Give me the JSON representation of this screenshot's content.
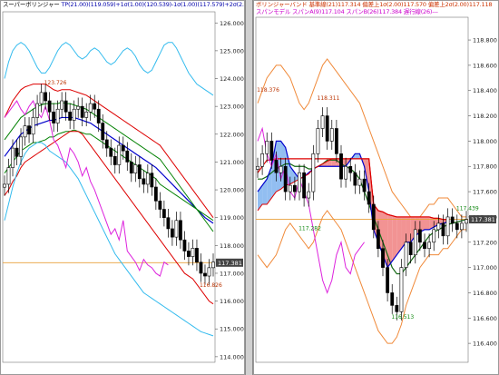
{
  "left": {
    "header": {
      "title": "スーパーボリンジャー",
      "params": "TP(21.00)(119.059)+1σ(1.00)(120.539)-1σ(1.00)(117.579)+2σ(2.00)(122.018)-2σ(2.00)"
    },
    "price_tag": "117.381",
    "colors": {
      "mid": "#0000cc",
      "s1": "#008000",
      "s2": "#dd0000",
      "s3": "#33bbee",
      "chikou": "#dd22dd",
      "price": "#000000",
      "current": "#e8a13a"
    }
  },
  "right": {
    "header": {
      "line1": "ボリンジャーバンド  基準線(21)117.314  偏差上1σ(2.00)117.570  偏差上2σ(2.00)117.118",
      "line2": "スパンモデル  スパンA(9)117.104  スパンB(26)117.384  遅行線(26)---"
    },
    "price_tag": "117.381",
    "colors": {
      "bb_outer": "#f08a3a",
      "mid": "#116611",
      "red_line": "#dd0000",
      "blue_line": "#0000cc",
      "chikou": "#dd22dd",
      "cloud_up": "#7fb3ee",
      "cloud_down": "#f08080"
    }
  },
  "chart_data": [
    {
      "type": "line",
      "title": "スーパーボリンジャー",
      "y_ticks": [
        "126.000",
        "125.000",
        "124.000",
        "123.000",
        "122.000",
        "121.000",
        "120.000",
        "119.000",
        "118.000",
        "117.000",
        "116.000",
        "115.000",
        "114.000"
      ],
      "ylim": [
        113.8,
        126.4
      ],
      "current_price": 117.381,
      "annotations": [
        {
          "text": "123.726",
          "x": 11,
          "y": 123.726
        },
        {
          "text": "116.826",
          "x": 49,
          "y": 116.45
        }
      ],
      "close": [
        120.2,
        120.8,
        121.5,
        121.2,
        121.9,
        122.3,
        122.0,
        122.6,
        123.1,
        123.5,
        123.2,
        122.8,
        122.4,
        122.9,
        123.2,
        122.8,
        122.5,
        122.9,
        123.0,
        122.6,
        122.8,
        123.1,
        122.9,
        122.4,
        121.8,
        121.5,
        121.2,
        120.9,
        121.6,
        121.4,
        121.0,
        120.6,
        120.9,
        120.4,
        120.2,
        120.6,
        120.1,
        119.6,
        119.3,
        119.0,
        118.6,
        118.3,
        118.9,
        118.2,
        117.8,
        117.6,
        117.9,
        117.4,
        117.0,
        116.9,
        117.2,
        117.4
      ],
      "series": [
        {
          "name": "mid",
          "values": [
            121.2,
            121.4,
            121.6,
            121.8,
            122.0,
            122.1,
            122.2,
            122.3,
            122.35,
            122.4,
            122.45,
            122.5,
            122.5,
            122.55,
            122.6,
            122.6,
            122.6,
            122.6,
            122.55,
            122.5,
            122.45,
            122.4,
            122.3,
            122.2,
            122.1,
            122.0,
            121.9,
            121.8,
            121.7,
            121.6,
            121.5,
            121.4,
            121.3,
            121.2,
            121.1,
            121.0,
            120.9,
            120.8,
            120.65,
            120.5,
            120.35,
            120.2,
            120.05,
            119.9,
            119.75,
            119.6,
            119.45,
            119.3,
            119.15,
            119.0,
            118.9,
            118.8
          ]
        },
        {
          "name": "+1σ",
          "values": [
            121.8,
            122.0,
            122.2,
            122.4,
            122.6,
            122.7,
            122.8,
            122.9,
            123.0,
            123.05,
            123.1,
            123.1,
            123.1,
            123.1,
            123.15,
            123.1,
            123.1,
            123.05,
            123.0,
            122.95,
            122.9,
            122.8,
            122.7,
            122.6,
            122.5,
            122.4,
            122.3,
            122.2,
            122.1,
            122.0,
            121.9,
            121.8,
            121.7,
            121.6,
            121.5,
            121.4,
            121.3,
            121.2,
            121.1,
            120.9,
            120.7,
            120.5,
            120.3,
            120.1,
            119.9,
            119.7,
            119.5,
            119.3,
            119.1,
            118.9,
            118.7,
            118.5
          ]
        },
        {
          "name": "-1σ",
          "values": [
            120.6,
            120.8,
            121.0,
            121.2,
            121.4,
            121.5,
            121.6,
            121.7,
            121.7,
            121.75,
            121.8,
            121.9,
            121.9,
            122.0,
            122.05,
            122.1,
            122.1,
            122.15,
            122.1,
            122.05,
            122.0,
            122.0,
            121.9,
            121.8,
            121.7,
            121.6,
            121.5,
            121.4,
            121.3,
            121.2,
            121.1,
            121.0,
            120.9,
            120.8,
            120.7,
            120.6,
            120.5,
            120.4,
            120.2,
            120.1,
            120.0,
            119.9,
            119.8,
            119.7,
            119.6,
            119.5,
            119.4,
            119.3,
            119.2,
            119.1,
            119.0,
            118.9
          ]
        },
        {
          "name": "+2σ",
          "values": [
            122.6,
            122.9,
            123.2,
            123.4,
            123.6,
            123.7,
            123.75,
            123.8,
            123.8,
            123.8,
            123.8,
            123.7,
            123.6,
            123.55,
            123.6,
            123.6,
            123.6,
            123.55,
            123.5,
            123.45,
            123.4,
            123.3,
            123.2,
            123.1,
            123.0,
            122.9,
            122.8,
            122.7,
            122.6,
            122.5,
            122.4,
            122.3,
            122.2,
            122.1,
            122.0,
            121.9,
            121.8,
            121.7,
            121.6,
            121.4,
            121.2,
            121.0,
            120.8,
            120.6,
            120.4,
            120.2,
            120.0,
            119.8,
            119.6,
            119.4,
            119.2,
            119.0
          ]
        },
        {
          "name": "-2σ",
          "values": [
            119.8,
            120.0,
            120.3,
            120.5,
            120.8,
            121.0,
            121.1,
            121.2,
            121.3,
            121.4,
            121.5,
            121.6,
            121.7,
            121.8,
            121.9,
            122.0,
            122.1,
            122.1,
            122.1,
            122.0,
            121.8,
            121.6,
            121.4,
            121.2,
            121.0,
            120.8,
            120.6,
            120.4,
            120.2,
            120.0,
            119.8,
            119.6,
            119.4,
            119.2,
            119.0,
            118.8,
            118.6,
            118.4,
            118.2,
            118.0,
            117.8,
            117.6,
            117.4,
            117.2,
            117.0,
            116.9,
            116.8,
            116.6,
            116.4,
            116.2,
            116.0,
            115.9
          ]
        },
        {
          "name": "+3σ",
          "values": [
            124.0,
            124.6,
            125.0,
            125.2,
            125.3,
            125.2,
            125.0,
            124.7,
            124.4,
            124.2,
            124.2,
            124.4,
            124.7,
            125.0,
            125.2,
            125.3,
            125.2,
            125.0,
            124.8,
            124.7,
            124.8,
            125.0,
            125.1,
            125.0,
            124.8,
            124.6,
            124.5,
            124.6,
            124.8,
            125.0,
            125.1,
            125.0,
            124.8,
            124.5,
            124.3,
            124.2,
            124.3,
            124.6,
            124.9,
            125.2,
            125.3,
            125.3,
            125.1,
            124.8,
            124.5,
            124.2,
            124.0,
            123.8,
            123.7,
            123.6,
            123.5,
            123.4
          ]
        },
        {
          "name": "-3σ",
          "values": [
            118.9,
            119.5,
            120.1,
            120.6,
            121.0,
            121.3,
            121.5,
            121.6,
            121.7,
            121.7,
            121.6,
            121.4,
            121.3,
            121.2,
            121.1,
            121.0,
            120.8,
            120.6,
            120.4,
            120.1,
            119.8,
            119.5,
            119.2,
            118.9,
            118.6,
            118.3,
            118.0,
            117.7,
            117.5,
            117.3,
            117.1,
            116.9,
            116.7,
            116.5,
            116.3,
            116.2,
            116.1,
            116.0,
            115.9,
            115.8,
            115.7,
            115.6,
            115.5,
            115.4,
            115.3,
            115.2,
            115.1,
            115.0,
            114.9,
            114.85,
            114.8,
            114.75
          ]
        },
        {
          "name": "chikou",
          "values": [
            122.6,
            122.8,
            123.0,
            123.2,
            122.9,
            122.7,
            123.0,
            123.2,
            122.8,
            122.6,
            123.0,
            122.5,
            121.8,
            121.6,
            121.2,
            120.8,
            121.5,
            121.3,
            121.0,
            120.5,
            120.8,
            120.3,
            120.0,
            119.6,
            119.2,
            118.8,
            118.4,
            118.6,
            118.2,
            118.9,
            117.8,
            117.6,
            117.4,
            117.1,
            117.5,
            117.3,
            117.2,
            117.0,
            116.9,
            117.4,
            117.3
          ]
        }
      ]
    },
    {
      "type": "line",
      "title": "ボリンジャーバンド / スパンモデル",
      "y_ticks": [
        "118.800",
        "118.600",
        "118.400",
        "118.200",
        "118.000",
        "117.800",
        "117.600",
        "117.400",
        "117.200",
        "117.000",
        "116.800",
        "116.600",
        "116.400"
      ],
      "ylim": [
        116.25,
        118.98
      ],
      "current_price": 117.381,
      "annotations": [
        {
          "text": "118.376",
          "x": 1,
          "y": 118.376
        },
        {
          "text": "118.311",
          "x": 14,
          "y": 118.311
        },
        {
          "text": "117.282",
          "x": 10,
          "y": 117.282
        },
        {
          "text": "117.439",
          "x": 44,
          "y": 117.439
        },
        {
          "text": "116.513",
          "x": 30,
          "y": 116.58
        }
      ],
      "close": [
        117.8,
        117.9,
        118.0,
        117.85,
        117.75,
        117.8,
        117.6,
        117.65,
        117.6,
        117.75,
        117.55,
        117.6,
        117.9,
        118.1,
        118.2,
        118.0,
        118.1,
        117.9,
        117.7,
        117.8,
        117.75,
        117.65,
        117.7,
        117.6,
        117.5,
        117.3,
        117.15,
        117.0,
        116.8,
        116.7,
        116.65,
        117.0,
        117.2,
        117.1,
        117.3,
        117.2,
        117.15,
        117.2,
        117.3,
        117.35,
        117.25,
        117.4,
        117.35,
        117.3,
        117.35,
        117.38
      ],
      "series": [
        {
          "name": "bb_upper",
          "values": [
            118.3,
            118.4,
            118.5,
            118.55,
            118.6,
            118.6,
            118.55,
            118.5,
            118.4,
            118.3,
            118.25,
            118.3,
            118.4,
            118.5,
            118.6,
            118.65,
            118.6,
            118.55,
            118.5,
            118.45,
            118.4,
            118.35,
            118.3,
            118.2,
            118.1,
            118.0,
            117.9,
            117.8,
            117.7,
            117.6,
            117.55,
            117.5,
            117.45,
            117.4,
            117.4,
            117.4,
            117.45,
            117.5,
            117.5,
            117.55,
            117.55,
            117.55,
            117.5,
            117.45,
            117.4,
            117.4
          ]
        },
        {
          "name": "bb_lower",
          "values": [
            117.1,
            117.05,
            117.0,
            117.05,
            117.1,
            117.2,
            117.3,
            117.35,
            117.3,
            117.25,
            117.2,
            117.15,
            117.2,
            117.3,
            117.4,
            117.45,
            117.4,
            117.35,
            117.3,
            117.2,
            117.1,
            117.0,
            116.9,
            116.8,
            116.7,
            116.6,
            116.5,
            116.45,
            116.4,
            116.4,
            116.45,
            116.55,
            116.7,
            116.8,
            116.9,
            117.0,
            117.05,
            117.1,
            117.1,
            117.1,
            117.15,
            117.15,
            117.2,
            117.25,
            117.3,
            117.3
          ]
        },
        {
          "name": "mid",
          "values": [
            117.7,
            117.7,
            117.72,
            117.75,
            117.78,
            117.8,
            117.82,
            117.82,
            117.8,
            117.8,
            117.8,
            117.78,
            117.78,
            117.8,
            117.82,
            117.85,
            117.85,
            117.85,
            117.82,
            117.8,
            117.78,
            117.75,
            117.7,
            117.6,
            117.5,
            117.4,
            117.3,
            117.2,
            117.1,
            117.0,
            116.95,
            116.95,
            117.0,
            117.05,
            117.1,
            117.15,
            117.2,
            117.25,
            117.28,
            117.3,
            117.32,
            117.34,
            117.35,
            117.36,
            117.37,
            117.38
          ]
        },
        {
          "name": "span_a",
          "values": [
            117.6,
            117.65,
            117.7,
            117.8,
            118.0,
            118.0,
            117.95,
            117.8,
            117.75,
            117.7,
            117.72,
            117.75,
            117.78,
            117.8,
            117.8,
            117.8,
            117.8,
            117.8,
            117.8,
            117.8,
            117.85,
            117.9,
            117.9,
            117.8,
            117.6,
            117.3,
            117.2,
            117.1,
            117.0,
            117.05,
            117.1,
            117.15,
            117.2,
            117.2,
            117.25,
            117.28,
            117.3,
            117.3,
            117.32,
            117.34,
            117.35,
            117.36
          ]
        },
        {
          "name": "span_b",
          "values": [
            117.45,
            117.5,
            117.5,
            117.55,
            117.6,
            117.62,
            117.65,
            117.66,
            117.68,
            117.7,
            117.72,
            117.74,
            117.78,
            117.8,
            117.82,
            117.84,
            117.86,
            117.86,
            117.86,
            117.86,
            117.86,
            117.86,
            117.86,
            117.86,
            117.86,
            117.5,
            117.45,
            117.44,
            117.42,
            117.41,
            117.4,
            117.4,
            117.4,
            117.4,
            117.4,
            117.4,
            117.4,
            117.4,
            117.39,
            117.39,
            117.38,
            117.38
          ]
        },
        {
          "name": "red_line",
          "values": [
            117.75,
            117.8,
            117.85,
            117.85,
            117.86,
            117.86,
            117.86,
            117.86,
            117.86,
            117.86,
            117.86,
            117.86,
            117.86,
            117.86,
            117.86,
            117.86,
            117.86,
            117.86,
            117.86,
            117.86,
            117.86,
            117.86,
            117.86,
            117.86,
            117.86,
            117.5,
            117.45,
            117.44,
            117.42,
            117.41,
            117.4,
            117.4,
            117.4,
            117.4,
            117.4,
            117.4,
            117.4,
            117.4,
            117.39,
            117.39,
            117.38,
            117.38
          ]
        },
        {
          "name": "chikou",
          "values": [
            118.0,
            118.1,
            117.9,
            117.8,
            117.9,
            117.7,
            117.8,
            117.6,
            117.55,
            117.7,
            117.6,
            117.5,
            117.3,
            117.1,
            116.9,
            116.8,
            116.9,
            117.1,
            117.2,
            117.0,
            116.95,
            117.1,
            117.15,
            117.2
          ]
        }
      ]
    }
  ]
}
